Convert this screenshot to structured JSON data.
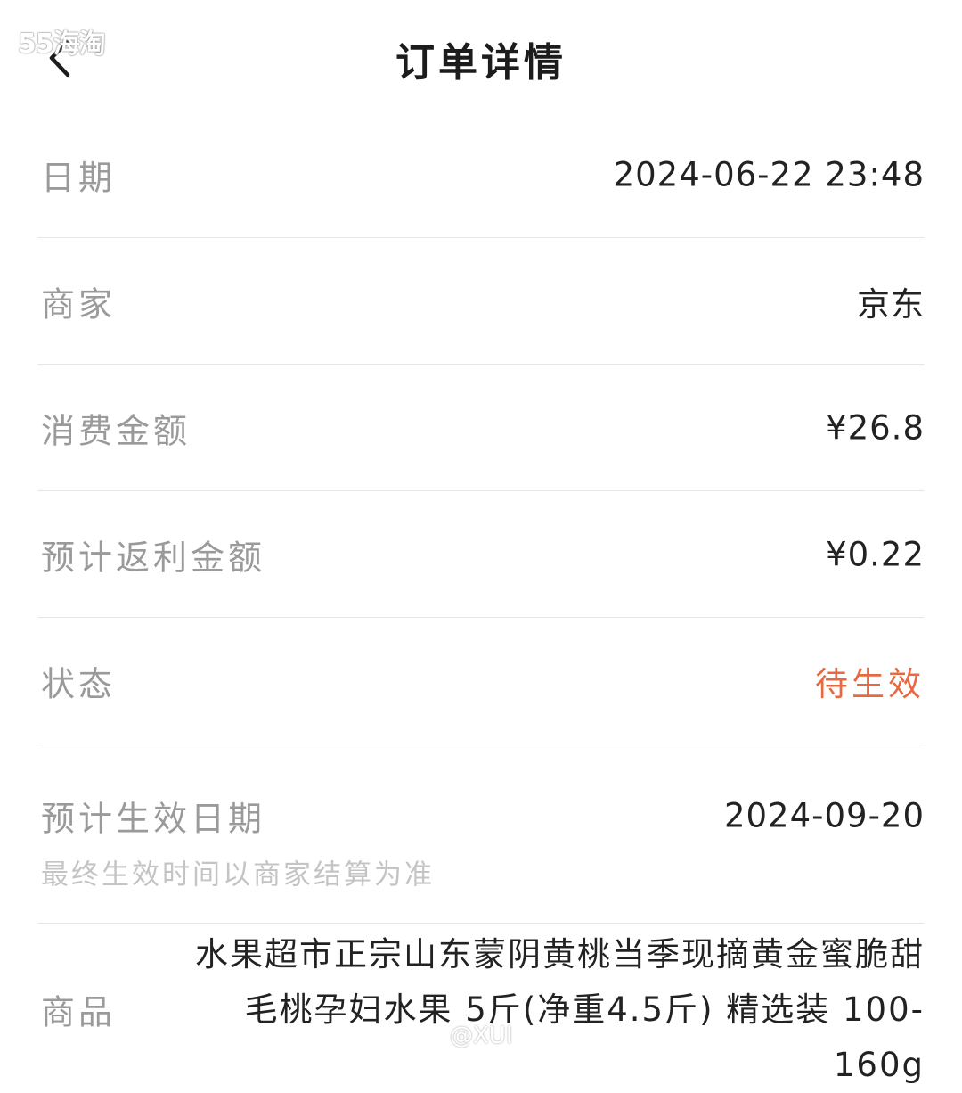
{
  "watermark": {
    "top": "55海淘",
    "bottom": "@XUI"
  },
  "header": {
    "title": "订单详情",
    "back_icon": "chevron-left-icon"
  },
  "details": {
    "date": {
      "label": "日期",
      "value": "2024-06-22 23:48"
    },
    "merchant": {
      "label": "商家",
      "value": "京东"
    },
    "amount": {
      "label": "消费金额",
      "value": "¥26.8"
    },
    "rebate": {
      "label": "预计返利金额",
      "value": "¥0.22"
    },
    "status": {
      "label": "状态",
      "value": "待生效",
      "color": "#e8683f"
    },
    "effective_date": {
      "label": "预计生效日期",
      "value": "2024-09-20",
      "note": "最终生效时间以商家结算为准"
    },
    "product": {
      "label": "商品",
      "value": "水果超市正宗山东蒙阴黄桃当季现摘黄金蜜脆甜毛桃孕妇水果 5斤(净重4.5斤) 精选装 100-160g"
    }
  }
}
